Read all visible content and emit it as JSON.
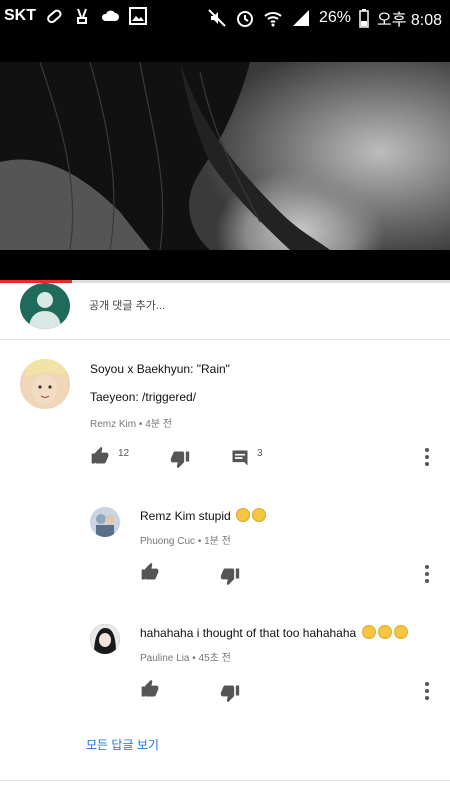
{
  "status_bar": {
    "carrier": "SKT",
    "battery": "26%",
    "time": "오후 8:08"
  },
  "video": {
    "progress_percent": 16
  },
  "add_comment": {
    "placeholder": "공개 댓글 추가..."
  },
  "comment": {
    "line1": "Soyou x Baekhyun: \"Rain\"",
    "line2": "Taeyeon: /triggered/",
    "author": "Remz Kim",
    "time": "4분 전",
    "likes": "12",
    "replies_count": "3"
  },
  "replies": [
    {
      "text": "Remz Kim stupid",
      "author": "Phuong Cuc",
      "time": "1분 전",
      "emoji_count": 2
    },
    {
      "text": "hahahaha i thought of that too hahahaha",
      "author": "Pauline Lia",
      "time": "45초 전",
      "emoji_count": 3
    }
  ],
  "view_all_replies": "모든 답글 보기",
  "colors": {
    "accent_blue": "#1a73e8",
    "progress_red": "#e52d27",
    "default_avatar": "#1f6a5a"
  }
}
